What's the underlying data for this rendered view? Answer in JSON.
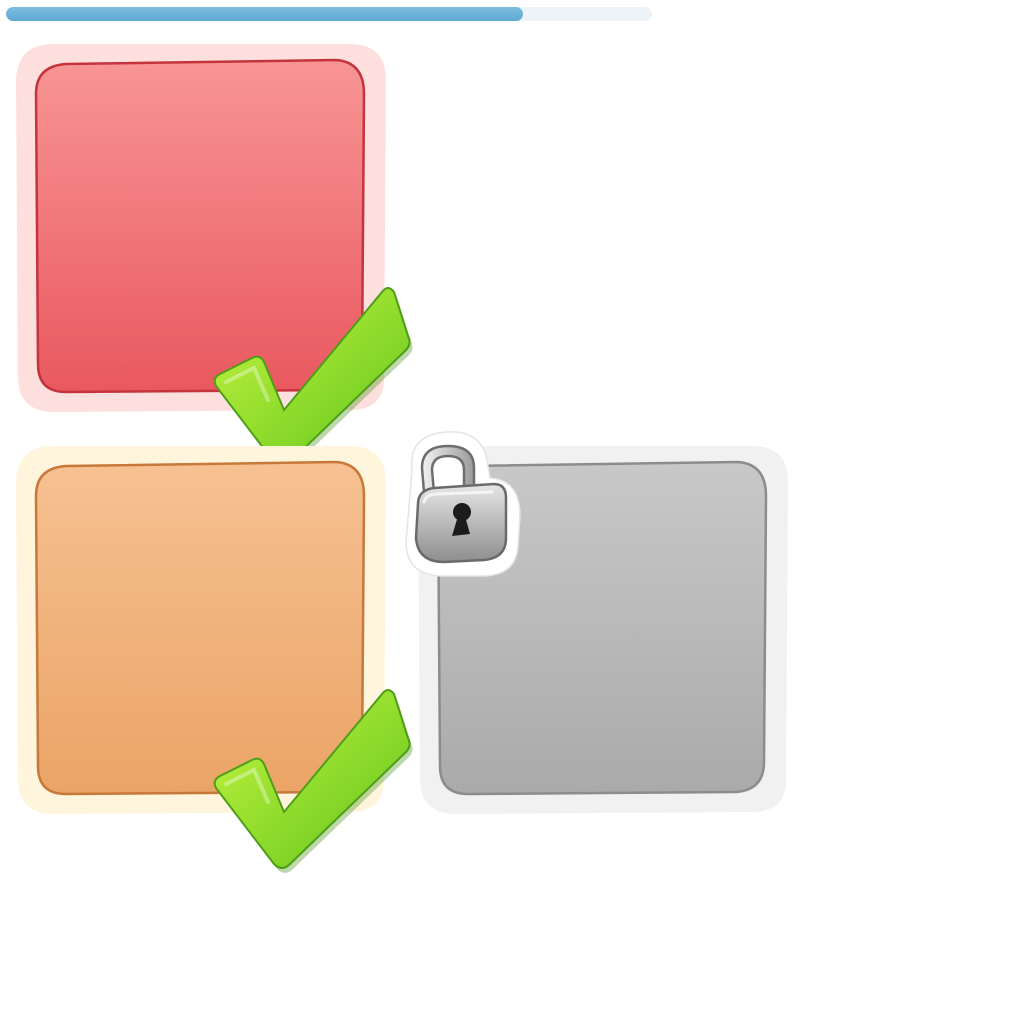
{
  "progress": {
    "fraction": 0.8,
    "color": "#67b1da"
  },
  "levels": [
    {
      "state": "completed",
      "frame_color": "#fde0de",
      "fill_top": "#f89595",
      "fill_bottom": "#e9585f",
      "border": "#c5343c",
      "icon": "checkmark-icon"
    },
    {
      "state": "completed",
      "frame_color": "#fef5dc",
      "fill_top": "#f6c192",
      "fill_bottom": "#eba466",
      "border": "#c7783a",
      "icon": "checkmark-icon"
    },
    {
      "state": "locked",
      "frame_color": "#f1f1f1",
      "fill_top": "#c8c8c8",
      "fill_bottom": "#aaaaaa",
      "border": "#8c8c8c",
      "icon": "padlock-icon"
    }
  ]
}
